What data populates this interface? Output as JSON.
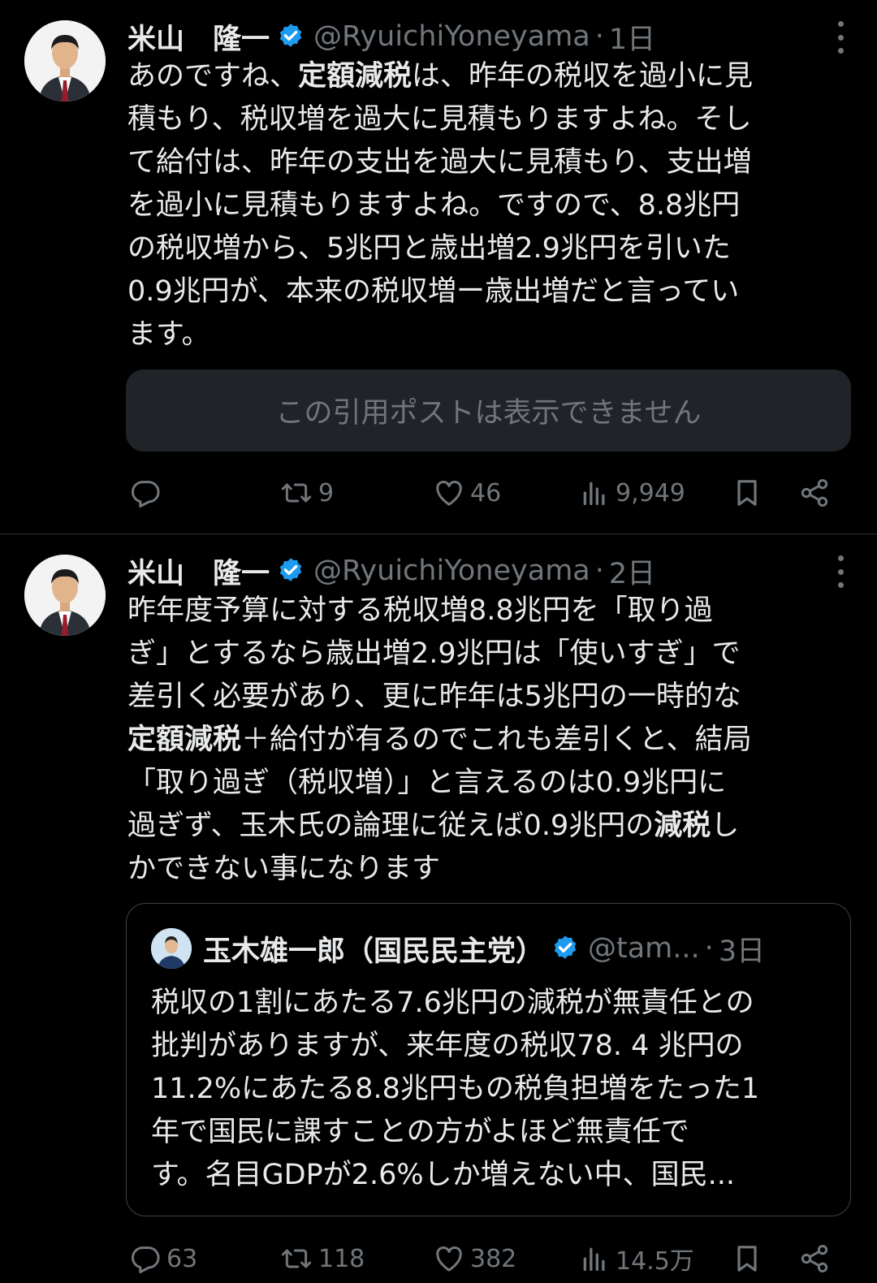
{
  "tweets": [
    {
      "author_name": "米山　隆一",
      "handle": "@RyuichiYoneyama",
      "separator": "·",
      "time": "1日",
      "body_lines": [
        [
          {
            "t": "あのですね、"
          },
          {
            "t": "定額減税",
            "b": true
          },
          {
            "t": "は、昨年の税収を過小に見"
          }
        ],
        [
          {
            "t": "積もり、税収増を過大に見積もりますよね。そし"
          }
        ],
        [
          {
            "t": "て給付は、昨年の支出を過大に見積もり、支出増"
          }
        ],
        [
          {
            "t": "を過小に見積もりますよね。ですので、8.8兆円"
          }
        ],
        [
          {
            "t": "の税収増から、5兆円と歳出増2.9兆円を引いた"
          }
        ],
        [
          {
            "t": "0.9兆円が、本来の税収増ー歳出増だと言ってい"
          }
        ],
        [
          {
            "t": "ます。"
          }
        ]
      ],
      "quote_unavailable": "この引用ポストは表示できません",
      "stats": {
        "replies": "",
        "reposts": "9",
        "likes": "46",
        "views": "9,949"
      }
    },
    {
      "author_name": "米山　隆一",
      "handle": "@RyuichiYoneyama",
      "separator": "·",
      "time": "2日",
      "body_lines": [
        [
          {
            "t": "昨年度予算に対する税収増8.8兆円を「取り過"
          }
        ],
        [
          {
            "t": "ぎ」とするなら歳出増2.9兆円は「使いすぎ」で"
          }
        ],
        [
          {
            "t": "差引く必要があり、更に昨年は5兆円の一時的な"
          }
        ],
        [
          {
            "t": "定額減税",
            "b": true
          },
          {
            "t": "＋給付が有るのでこれも差引くと、結局"
          }
        ],
        [
          {
            "t": "「取り過ぎ（税収増）」と言えるのは0.9兆円に"
          }
        ],
        [
          {
            "t": "過ぎず、玉木氏の論理に従えば0.9兆円の"
          },
          {
            "t": "減税",
            "b": true
          },
          {
            "t": "し"
          }
        ],
        [
          {
            "t": "かできない事になります"
          }
        ]
      ],
      "quote": {
        "author_name": "玉木雄一郎（国民民主党）",
        "handle": "@tam...",
        "separator": "·",
        "time": "3日",
        "body_lines": [
          "税収の1割にあたる7.6兆円の減税が無責任との",
          "批判がありますが、来年度の税収78. 4 兆円の",
          "11.2%にあたる8.8兆円もの税負担増をたった1",
          "年で国民に課すことの方がよほど無責任で",
          "す。名目GDPが2.6%しか増えない中、国民..."
        ]
      },
      "stats": {
        "replies": "63",
        "reposts": "118",
        "likes": "382",
        "views": "14.5万"
      }
    }
  ],
  "colors": {
    "background": "#000000",
    "text": "#e7e9ea",
    "muted": "#71767b",
    "verified": "#1d9bf0",
    "divider": "#2f3336"
  },
  "icons": [
    "reply-icon",
    "repost-icon",
    "like-icon",
    "views-icon",
    "bookmark-icon",
    "share-icon",
    "verified-badge-icon",
    "more-icon"
  ]
}
